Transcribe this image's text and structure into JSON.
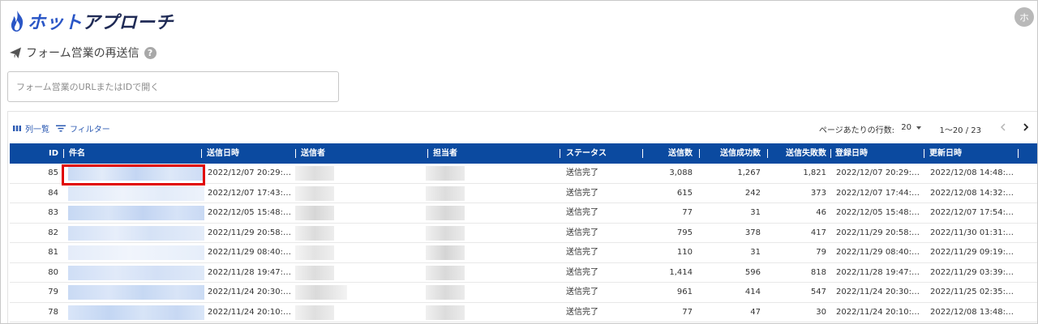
{
  "app": {
    "logo_prefix": "ホット",
    "logo_suffix": "アプローチ",
    "avatar_initial": "ホ"
  },
  "page": {
    "title": "フォーム営業の再送信",
    "help": "?"
  },
  "search": {
    "placeholder": "フォーム営業のURLまたはIDで開く",
    "value": ""
  },
  "toolbar": {
    "columns_label": "列一覧",
    "filter_label": "フィルター",
    "rows_per_page_label": "ページあたりの行数:",
    "rows_per_page_value": "20",
    "range": "1〜20 / 23"
  },
  "table": {
    "headers": {
      "id": "ID",
      "name": "件名",
      "sent_at": "送信日時",
      "sender": "送信者",
      "owner": "担当者",
      "status": "ステータス",
      "sent_count": "送信数",
      "success_count": "送信成功数",
      "fail_count": "送信失敗数",
      "registered_at": "登録日時",
      "updated_at": "更新日時"
    },
    "rows": [
      {
        "id": "85",
        "sent_at": "2022/12/07 20:29:…",
        "status": "送信完了",
        "sent_count": "3,088",
        "success_count": "1,267",
        "fail_count": "1,821",
        "registered_at": "2022/12/07 20:29:…",
        "updated_at": "2022/12/08 14:48:…"
      },
      {
        "id": "84",
        "sent_at": "2022/12/07 17:43:…",
        "status": "送信完了",
        "sent_count": "615",
        "success_count": "242",
        "fail_count": "373",
        "registered_at": "2022/12/07 17:44:…",
        "updated_at": "2022/12/08 14:32:…"
      },
      {
        "id": "83",
        "sent_at": "2022/12/05 15:48:…",
        "status": "送信完了",
        "sent_count": "77",
        "success_count": "31",
        "fail_count": "46",
        "registered_at": "2022/12/05 15:48:…",
        "updated_at": "2022/12/07 17:54:…"
      },
      {
        "id": "82",
        "sent_at": "2022/11/29 20:58:…",
        "status": "送信完了",
        "sent_count": "795",
        "success_count": "378",
        "fail_count": "417",
        "registered_at": "2022/11/29 20:58:…",
        "updated_at": "2022/11/30 01:31:…"
      },
      {
        "id": "81",
        "sent_at": "2022/11/29 08:40:…",
        "status": "送信完了",
        "sent_count": "110",
        "success_count": "31",
        "fail_count": "79",
        "registered_at": "2022/11/29 08:40:…",
        "updated_at": "2022/11/29 09:19:…"
      },
      {
        "id": "80",
        "sent_at": "2022/11/28 19:47:…",
        "status": "送信完了",
        "sent_count": "1,414",
        "success_count": "596",
        "fail_count": "818",
        "registered_at": "2022/11/28 19:47:…",
        "updated_at": "2022/11/29 03:39:…"
      },
      {
        "id": "79",
        "sent_at": "2022/11/24 20:30:…",
        "status": "送信完了",
        "sent_count": "961",
        "success_count": "414",
        "fail_count": "547",
        "registered_at": "2022/11/24 20:30:…",
        "updated_at": "2022/11/25 02:35:…"
      },
      {
        "id": "78",
        "sent_at": "2022/11/24 20:10:…",
        "status": "送信完了",
        "sent_count": "77",
        "success_count": "47",
        "fail_count": "30",
        "registered_at": "2022/11/24 20:10:…",
        "updated_at": "2022/12/08 13:48:…"
      }
    ]
  },
  "colors": {
    "header_bg": "#0b4aa0",
    "accent": "#2d5bb3",
    "highlight": "#e00000"
  },
  "icons": {
    "logo": "flame-icon",
    "title": "paper-plane-icon",
    "help": "question-icon",
    "columns": "columns-icon",
    "filter": "filter-icon",
    "prev": "chevron-left-icon",
    "next": "chevron-right-icon"
  }
}
